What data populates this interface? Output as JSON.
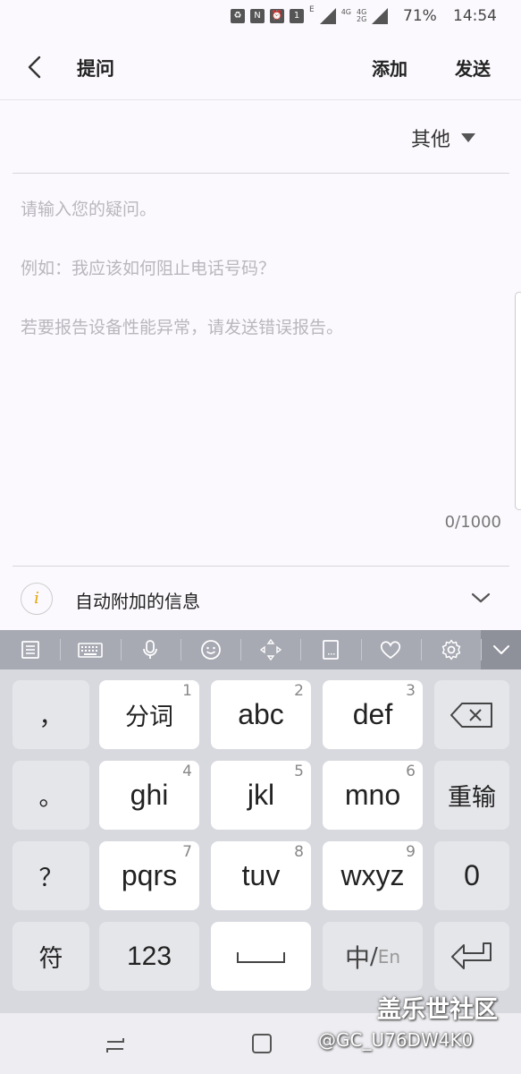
{
  "status_bar": {
    "battery_percent": "71%",
    "time": "14:54",
    "icons": [
      "recycle-icon",
      "nfc-icon",
      "alarm-icon",
      "sim-1-icon",
      "e-network-icon",
      "signal-icon",
      "4g-icon",
      "4g-2g-icon",
      "signal-2-icon"
    ],
    "sim_label": "1",
    "e_label": "E",
    "net1": "4G",
    "net2_top": "4G",
    "net2_bottom": "2G"
  },
  "app_bar": {
    "title": "提问",
    "add_label": "添加",
    "send_label": "发送"
  },
  "category": {
    "selected": "其他"
  },
  "question": {
    "hints": [
      "请输入您的疑问。",
      "例如：我应该如何阻止电话号码？",
      "若要报告设备性能异常，请发送错误报告。"
    ],
    "char_count": "0/1000"
  },
  "auto_info": {
    "icon_glyph": "i",
    "label": "自动附加的信息"
  },
  "keyboard": {
    "toolbar": [
      "clipboard-icon",
      "keyboard-icon",
      "microphone-icon",
      "emoji-icon",
      "cursor-move-icon",
      "handwriting-icon",
      "sticker-heart-icon",
      "settings-icon",
      "collapse-keyboard-icon"
    ],
    "rows": [
      {
        "left": "，",
        "keys": [
          {
            "label": "分词",
            "num": "1"
          },
          {
            "label": "abc",
            "num": "2"
          },
          {
            "label": "def",
            "num": "3"
          }
        ],
        "right": "backspace"
      },
      {
        "left": "。",
        "keys": [
          {
            "label": "ghi",
            "num": "4"
          },
          {
            "label": "jkl",
            "num": "5"
          },
          {
            "label": "mno",
            "num": "6"
          }
        ],
        "right": "重输"
      },
      {
        "left": "？",
        "keys": [
          {
            "label": "pqrs",
            "num": "7"
          },
          {
            "label": "tuv",
            "num": "8"
          },
          {
            "label": "wxyz",
            "num": "9"
          }
        ],
        "right": "0"
      }
    ],
    "bottom": {
      "symbols": "符",
      "numbers": "123",
      "lang_zh": "中",
      "lang_sep": "/",
      "lang_en": "En"
    }
  },
  "watermark": {
    "title": "盖乐世社区",
    "handle": "@GC_U76DW4K0"
  }
}
